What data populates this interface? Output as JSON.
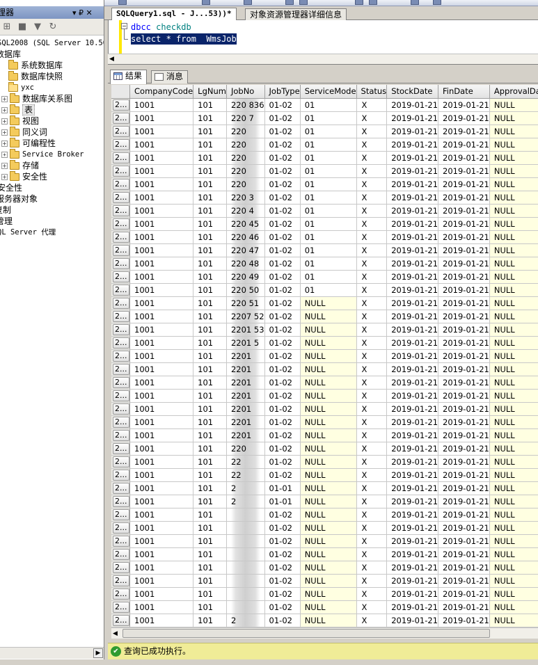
{
  "explorer": {
    "title": "理器",
    "pin_label": "▾ ₽ ✕",
    "tree": [
      {
        "label": "SQL2008 (SQL Server 10.50",
        "mono": true,
        "x": -4
      },
      {
        "label": "数据库",
        "x": -6
      },
      {
        "label": "系统数据库",
        "x": 0,
        "folder": true
      },
      {
        "label": "数据库快照",
        "x": 0,
        "folder": true
      },
      {
        "label": "yxc",
        "x": 0,
        "folder": true,
        "open": true,
        "mono": true
      },
      {
        "label": "数据库关系图",
        "x": 2,
        "folder": true,
        "exp": "+"
      },
      {
        "label": "表",
        "x": 2,
        "folder": true,
        "exp": "+",
        "selected": true
      },
      {
        "label": "视图",
        "x": 2,
        "folder": true,
        "exp": "+"
      },
      {
        "label": "同义词",
        "x": 2,
        "folder": true,
        "exp": "+"
      },
      {
        "label": "可编程性",
        "x": 2,
        "folder": true,
        "exp": "+"
      },
      {
        "label": "Service Broker",
        "x": 2,
        "folder": true,
        "exp": "+",
        "mono": true
      },
      {
        "label": "存储",
        "x": 2,
        "folder": true,
        "exp": "+"
      },
      {
        "label": "安全性",
        "x": 2,
        "folder": true,
        "exp": "+"
      },
      {
        "label": "安全性",
        "x": -4
      },
      {
        "label": "服务器对象",
        "x": -6
      },
      {
        "label": "复制",
        "x": -8
      },
      {
        "label": "管理",
        "x": -6
      },
      {
        "label": "QL Server 代理",
        "x": -4,
        "mono": true
      }
    ]
  },
  "tabs": {
    "query": "SQLQuery1.sql - J...53))*",
    "details": "对象资源管理器详细信息"
  },
  "editor": {
    "line1_kw": "dbcc",
    "line1_id": "checkdb",
    "line2_kw1": "select",
    "line2_mid": " * ",
    "line2_kw2": "from",
    "line2_id": "WmsJob"
  },
  "results": {
    "tab_results": "结果",
    "tab_messages": "消息",
    "columns": [
      "CompanyCode",
      "LgNum",
      "JobNo",
      "JobType",
      "ServiceMode",
      "Status",
      "StockDate",
      "FinDate",
      "ApprovalDa"
    ],
    "row_header": "2...",
    "rows": [
      [
        "1001",
        "101",
        "220 836",
        "01-02",
        "01",
        "X",
        "2019-01-21",
        "2019-01-21",
        "NULL"
      ],
      [
        "1001",
        "101",
        "220 7",
        "01-02",
        "01",
        "X",
        "2019-01-21",
        "2019-01-21",
        "NULL"
      ],
      [
        "1001",
        "101",
        "220",
        "01-02",
        "01",
        "X",
        "2019-01-21",
        "2019-01-21",
        "NULL"
      ],
      [
        "1001",
        "101",
        "220",
        "01-02",
        "01",
        "X",
        "2019-01-21",
        "2019-01-21",
        "NULL"
      ],
      [
        "1001",
        "101",
        "220",
        "01-02",
        "01",
        "X",
        "2019-01-21",
        "2019-01-21",
        "NULL"
      ],
      [
        "1001",
        "101",
        "220",
        "01-02",
        "01",
        "X",
        "2019-01-21",
        "2019-01-21",
        "NULL"
      ],
      [
        "1001",
        "101",
        "220",
        "01-02",
        "01",
        "X",
        "2019-01-21",
        "2019-01-21",
        "NULL"
      ],
      [
        "1001",
        "101",
        "220 3",
        "01-02",
        "01",
        "X",
        "2019-01-21",
        "2019-01-21",
        "NULL"
      ],
      [
        "1001",
        "101",
        "220 4",
        "01-02",
        "01",
        "X",
        "2019-01-21",
        "2019-01-21",
        "NULL"
      ],
      [
        "1001",
        "101",
        "220 45",
        "01-02",
        "01",
        "X",
        "2019-01-21",
        "2019-01-21",
        "NULL"
      ],
      [
        "1001",
        "101",
        "220 46",
        "01-02",
        "01",
        "X",
        "2019-01-21",
        "2019-01-21",
        "NULL"
      ],
      [
        "1001",
        "101",
        "220 47",
        "01-02",
        "01",
        "X",
        "2019-01-21",
        "2019-01-21",
        "NULL"
      ],
      [
        "1001",
        "101",
        "220 48",
        "01-02",
        "01",
        "X",
        "2019-01-21",
        "2019-01-21",
        "NULL"
      ],
      [
        "1001",
        "101",
        "220 49",
        "01-02",
        "01",
        "X",
        "2019-01-21",
        "2019-01-21",
        "NULL"
      ],
      [
        "1001",
        "101",
        "220 50",
        "01-02",
        "01",
        "X",
        "2019-01-21",
        "2019-01-21",
        "NULL"
      ],
      [
        "1001",
        "101",
        "220 51",
        "01-02",
        "NULL",
        "X",
        "2019-01-21",
        "2019-01-21",
        "NULL"
      ],
      [
        "1001",
        "101",
        "2207 52",
        "01-02",
        "NULL",
        "X",
        "2019-01-21",
        "2019-01-21",
        "NULL"
      ],
      [
        "1001",
        "101",
        "2201 53",
        "01-02",
        "NULL",
        "X",
        "2019-01-21",
        "2019-01-21",
        "NULL"
      ],
      [
        "1001",
        "101",
        "2201 5",
        "01-02",
        "NULL",
        "X",
        "2019-01-21",
        "2019-01-21",
        "NULL"
      ],
      [
        "1001",
        "101",
        "2201",
        "01-02",
        "NULL",
        "X",
        "2019-01-21",
        "2019-01-21",
        "NULL"
      ],
      [
        "1001",
        "101",
        "2201",
        "01-02",
        "NULL",
        "X",
        "2019-01-21",
        "2019-01-21",
        "NULL"
      ],
      [
        "1001",
        "101",
        "2201",
        "01-02",
        "NULL",
        "X",
        "2019-01-21",
        "2019-01-21",
        "NULL"
      ],
      [
        "1001",
        "101",
        "2201",
        "01-02",
        "NULL",
        "X",
        "2019-01-21",
        "2019-01-21",
        "NULL"
      ],
      [
        "1001",
        "101",
        "2201",
        "01-02",
        "NULL",
        "X",
        "2019-01-21",
        "2019-01-21",
        "NULL"
      ],
      [
        "1001",
        "101",
        "2201",
        "01-02",
        "NULL",
        "X",
        "2019-01-21",
        "2019-01-21",
        "NULL"
      ],
      [
        "1001",
        "101",
        "2201",
        "01-02",
        "NULL",
        "X",
        "2019-01-21",
        "2019-01-21",
        "NULL"
      ],
      [
        "1001",
        "101",
        "220",
        "01-02",
        "NULL",
        "X",
        "2019-01-21",
        "2019-01-21",
        "NULL"
      ],
      [
        "1001",
        "101",
        "22",
        "01-02",
        "NULL",
        "X",
        "2019-01-21",
        "2019-01-21",
        "NULL"
      ],
      [
        "1001",
        "101",
        "22",
        "01-02",
        "NULL",
        "X",
        "2019-01-21",
        "2019-01-21",
        "NULL"
      ],
      [
        "1001",
        "101",
        "2",
        "01-01",
        "NULL",
        "X",
        "2019-01-21",
        "2019-01-21",
        "NULL"
      ],
      [
        "1001",
        "101",
        "2",
        "01-01",
        "NULL",
        "X",
        "2019-01-21",
        "2019-01-21",
        "NULL"
      ],
      [
        "1001",
        "101",
        "",
        "01-02",
        "NULL",
        "X",
        "2019-01-21",
        "2019-01-21",
        "NULL"
      ],
      [
        "1001",
        "101",
        "",
        "01-02",
        "NULL",
        "X",
        "2019-01-21",
        "2019-01-21",
        "NULL"
      ],
      [
        "1001",
        "101",
        "",
        "01-02",
        "NULL",
        "X",
        "2019-01-21",
        "2019-01-21",
        "NULL"
      ],
      [
        "1001",
        "101",
        "",
        "01-02",
        "NULL",
        "X",
        "2019-01-21",
        "2019-01-21",
        "NULL"
      ],
      [
        "1001",
        "101",
        "",
        "01-02",
        "NULL",
        "X",
        "2019-01-21",
        "2019-01-21",
        "NULL"
      ],
      [
        "1001",
        "101",
        "",
        "01-02",
        "NULL",
        "X",
        "2019-01-21",
        "2019-01-21",
        "NULL"
      ],
      [
        "1001",
        "101",
        "",
        "01-02",
        "NULL",
        "X",
        "2019-01-21",
        "2019-01-21",
        "NULL"
      ],
      [
        "1001",
        "101",
        "",
        "01-02",
        "NULL",
        "X",
        "2019-01-21",
        "2019-01-21",
        "NULL"
      ],
      [
        "1001",
        "101",
        "2",
        "01-02",
        "NULL",
        "X",
        "2019-01-21",
        "2019-01-21",
        "NULL"
      ]
    ]
  },
  "status": {
    "message": "查询已成功执行。"
  },
  "colors": {
    "null_cell": "#ffffe1",
    "status_bar": "#f0ec97",
    "selection": "#0a246a",
    "keyword": "#0000ff",
    "identifier": "#008080"
  }
}
